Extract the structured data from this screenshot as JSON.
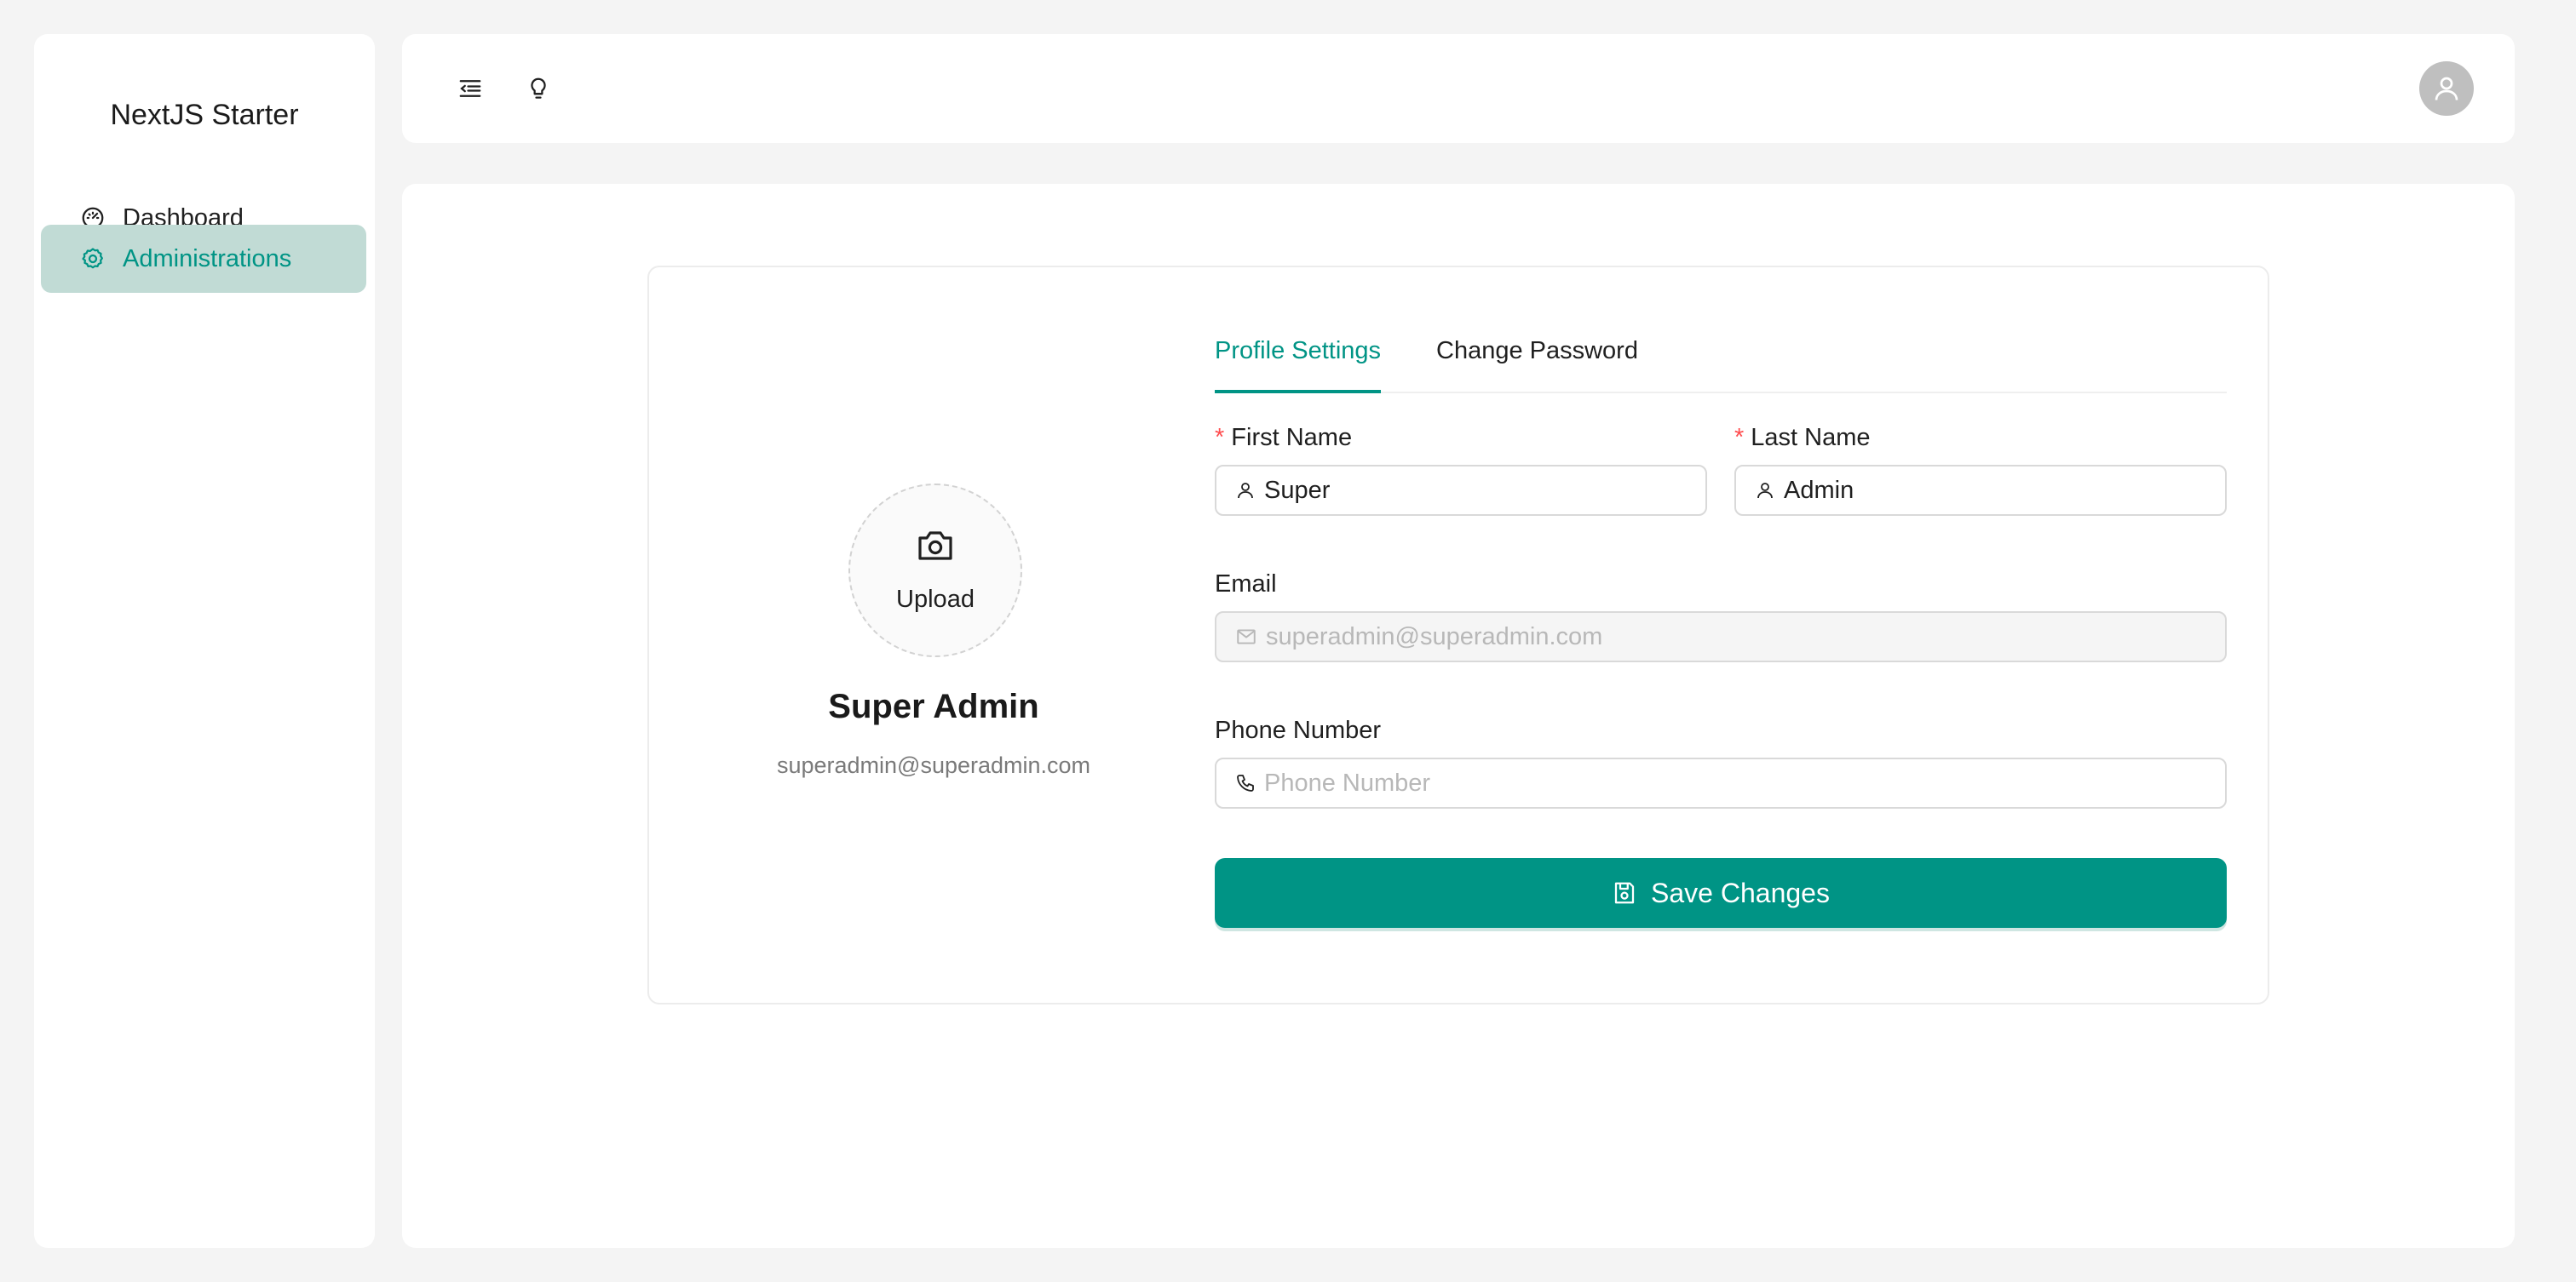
{
  "app": {
    "brand": "NextJS Starter"
  },
  "sidebar": {
    "items": [
      {
        "label": "Dashboard",
        "icon": "dashboard-icon",
        "active": false
      },
      {
        "label": "Administrations",
        "icon": "gear-icon",
        "active": true
      }
    ]
  },
  "header": {
    "icons": [
      "menu-fold-icon",
      "bulb-icon",
      "user-avatar-icon"
    ]
  },
  "profile": {
    "upload_label": "Upload",
    "name": "Super Admin",
    "email": "superadmin@superadmin.com"
  },
  "tabs": [
    {
      "label": "Profile Settings",
      "active": true
    },
    {
      "label": "Change Password",
      "active": false
    }
  ],
  "form": {
    "first_name": {
      "label": "First Name",
      "required_mark": "*",
      "value": "Super"
    },
    "last_name": {
      "label": "Last Name",
      "required_mark": "*",
      "value": "Admin"
    },
    "email": {
      "label": "Email",
      "placeholder": "superadmin@superadmin.com",
      "disabled": true
    },
    "phone": {
      "label": "Phone Number",
      "placeholder": "Phone Number",
      "value": ""
    },
    "save_label": "Save Changes"
  },
  "colors": {
    "accent": "#009485",
    "active_nav_bg": "#c1dbd5",
    "required": "#ff4d4f",
    "page_bg": "#f4f4f4"
  }
}
